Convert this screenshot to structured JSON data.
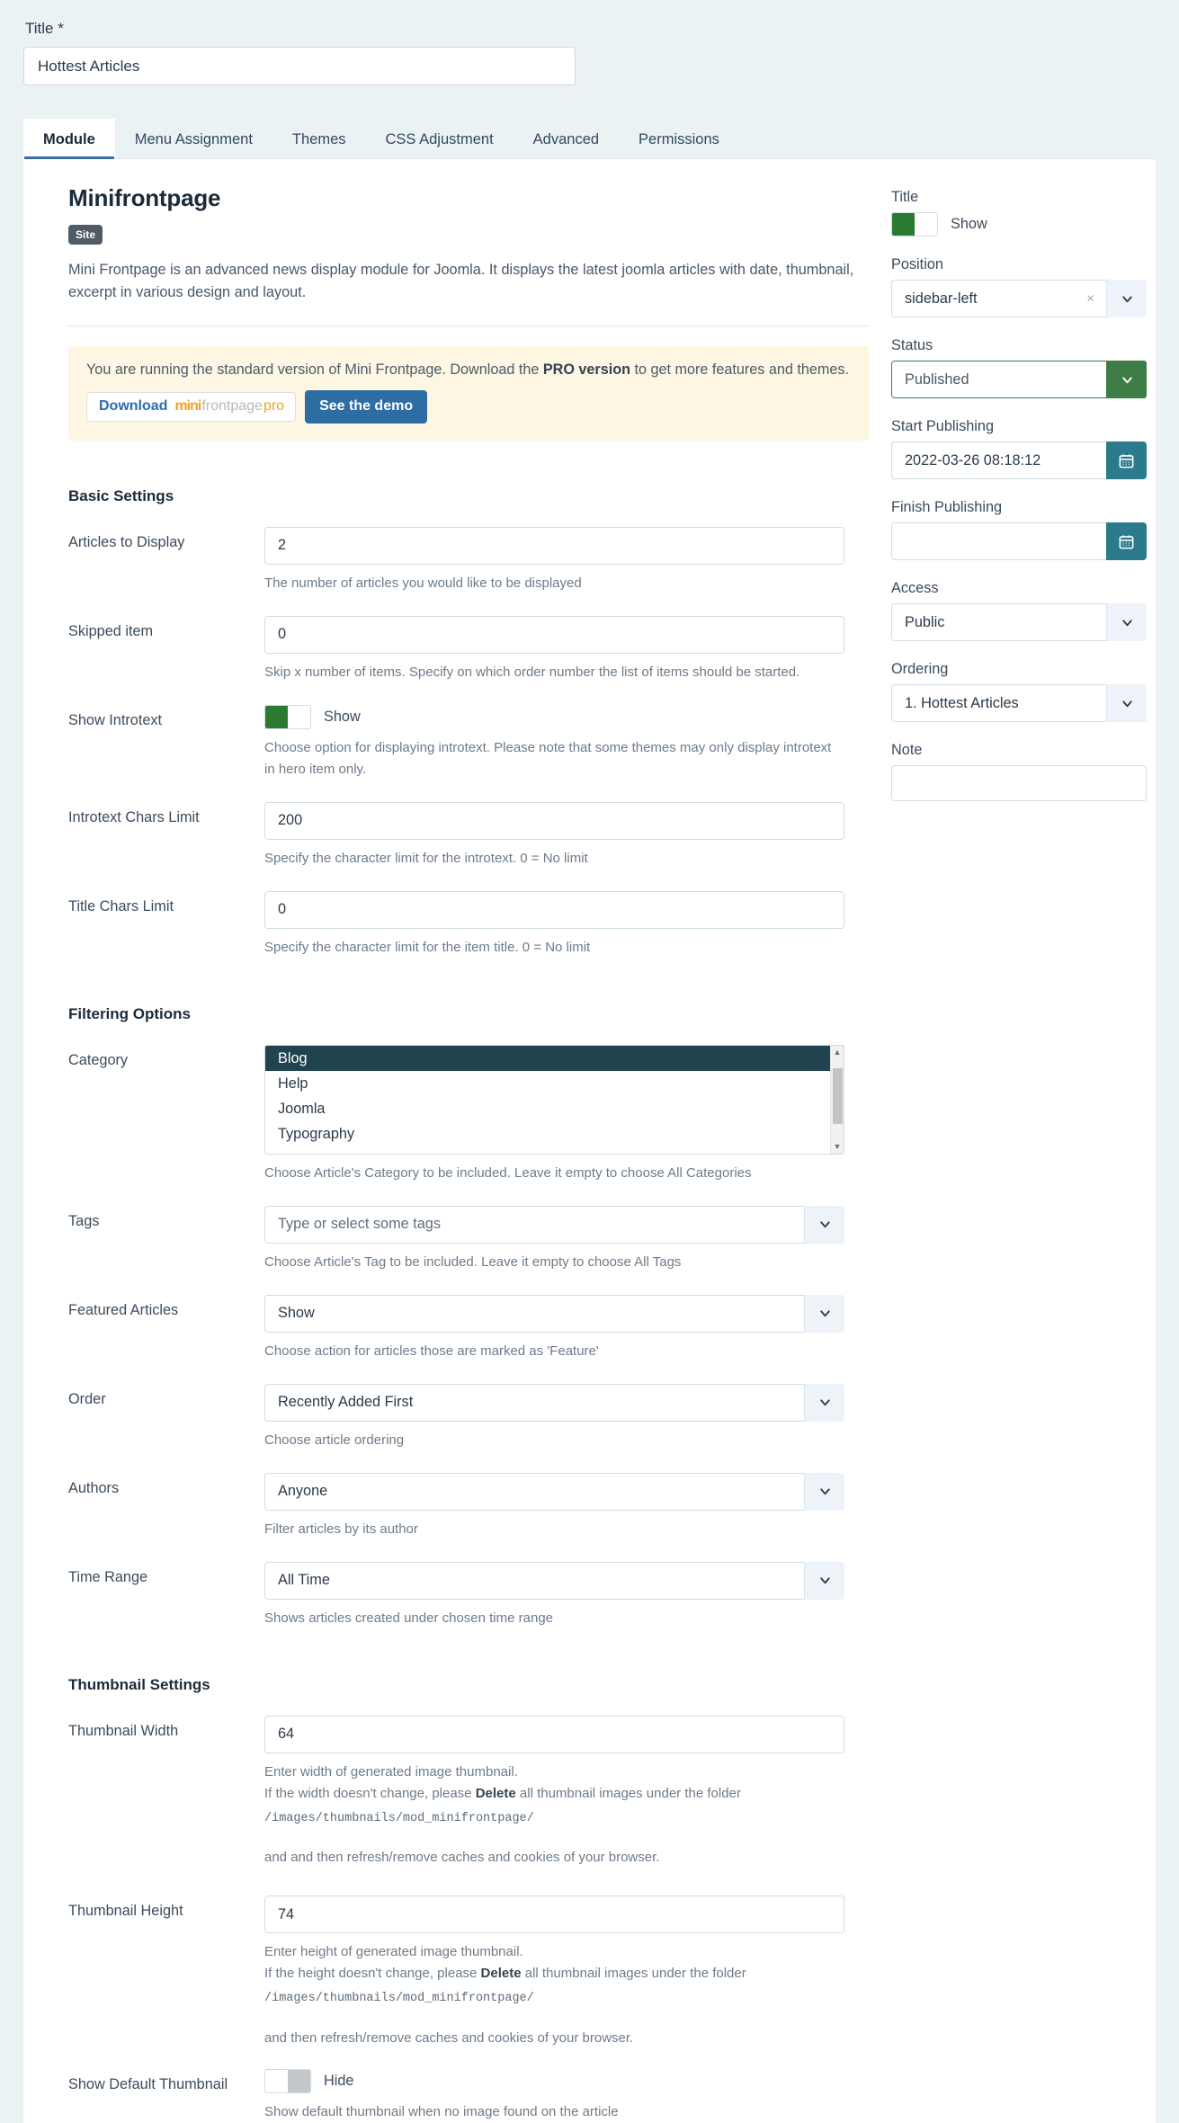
{
  "form": {
    "title_label": "Title *",
    "title_value": "Hottest Articles"
  },
  "tabs": [
    {
      "label": "Module",
      "active": true
    },
    {
      "label": "Menu Assignment",
      "active": false
    },
    {
      "label": "Themes",
      "active": false
    },
    {
      "label": "CSS Adjustment",
      "active": false
    },
    {
      "label": "Advanced",
      "active": false
    },
    {
      "label": "Permissions",
      "active": false
    }
  ],
  "module": {
    "name": "Minifrontpage",
    "badge": "Site",
    "description": "Mini Frontpage is an advanced news display module for Joomla. It displays the latest joomla articles with date, thumbnail, excerpt in various design and layout."
  },
  "alert": {
    "text_before": "You are running the standard version of Mini Frontpage. Download the ",
    "text_bold": "PRO version",
    "text_after": " to get more features and themes.",
    "download_word": "Download",
    "logo_mini": "mini",
    "logo_frontpage": "frontpage",
    "logo_pro": "pro",
    "demo_label": "See the demo"
  },
  "sections": {
    "basic": "Basic Settings",
    "filtering": "Filtering Options",
    "thumbnail": "Thumbnail Settings"
  },
  "fields": {
    "articles_to_display": {
      "label": "Articles to Display",
      "value": "2",
      "help": "The number of articles you would like to be displayed"
    },
    "skipped_item": {
      "label": "Skipped item",
      "value": "0",
      "help": "Skip x number of items. Specify on which order number the list of items should be started."
    },
    "show_introtext": {
      "label": "Show Introtext",
      "state": "Show",
      "help": "Choose option for displaying introtext. Please note that some themes may only display introtext in hero item only."
    },
    "introtext_chars_limit": {
      "label": "Introtext Chars Limit",
      "value": "200",
      "help": "Specify the character limit for the introtext. 0 = No limit"
    },
    "title_chars_limit": {
      "label": "Title Chars Limit",
      "value": "0",
      "help": "Specify the character limit for the item title. 0 = No limit"
    },
    "category": {
      "label": "Category",
      "options": [
        "Blog",
        "Help",
        "Joomla",
        "Typography"
      ],
      "selected": "Blog",
      "help": "Choose Article's Category to be included. Leave it empty to choose All Categories"
    },
    "tags": {
      "label": "Tags",
      "placeholder": "Type or select some tags",
      "help": "Choose Article's Tag to be included. Leave it empty to choose All Tags"
    },
    "featured_articles": {
      "label": "Featured Articles",
      "value": "Show",
      "help": "Choose action for articles those are marked as 'Feature'"
    },
    "order": {
      "label": "Order",
      "value": "Recently Added First",
      "help": "Choose article ordering"
    },
    "authors": {
      "label": "Authors",
      "value": "Anyone",
      "help": "Filter articles by its author"
    },
    "time_range": {
      "label": "Time Range",
      "value": "All Time",
      "help": "Shows articles created under chosen time range"
    },
    "thumbnail_width": {
      "label": "Thumbnail Width",
      "value": "64",
      "help_line1": "Enter width of generated image thumbnail.",
      "help_line2_before": "If the width doesn't change, please ",
      "help_line2_bold": "Delete",
      "help_line2_after": " all thumbnail images under the folder",
      "help_path": "/images/thumbnails/mod_minifrontpage/",
      "help_line3": "and and then refresh/remove caches and cookies of your browser."
    },
    "thumbnail_height": {
      "label": "Thumbnail Height",
      "value": "74",
      "help_line1": "Enter height of generated image thumbnail.",
      "help_line2_before": "If the height doesn't change, please ",
      "help_line2_bold": "Delete",
      "help_line2_after": " all thumbnail images under the folder",
      "help_path": "/images/thumbnails/mod_minifrontpage/",
      "help_line3": "and then refresh/remove caches and cookies of your browser."
    },
    "show_default_thumbnail": {
      "label": "Show Default Thumbnail",
      "state": "Hide",
      "help": "Show default thumbnail when no image found on the article"
    }
  },
  "sidebar": {
    "title": {
      "label": "Title",
      "state": "Show"
    },
    "position": {
      "label": "Position",
      "value": "sidebar-left"
    },
    "status": {
      "label": "Status",
      "value": "Published"
    },
    "start_publishing": {
      "label": "Start Publishing",
      "value": "2022-03-26 08:18:12"
    },
    "finish_publishing": {
      "label": "Finish Publishing",
      "value": ""
    },
    "access": {
      "label": "Access",
      "value": "Public"
    },
    "ordering": {
      "label": "Ordering",
      "value": "1. Hottest Articles"
    },
    "note": {
      "label": "Note",
      "value": ""
    }
  },
  "colors": {
    "page_bg": "#eaf2f4",
    "accent_blue": "#2e6da4",
    "toggle_green": "#2b7a32",
    "status_green": "#3e7d47",
    "calendar_teal": "#2b7b8c",
    "select_dark": "#1f4450",
    "alert_bg": "#fdf6e3"
  }
}
